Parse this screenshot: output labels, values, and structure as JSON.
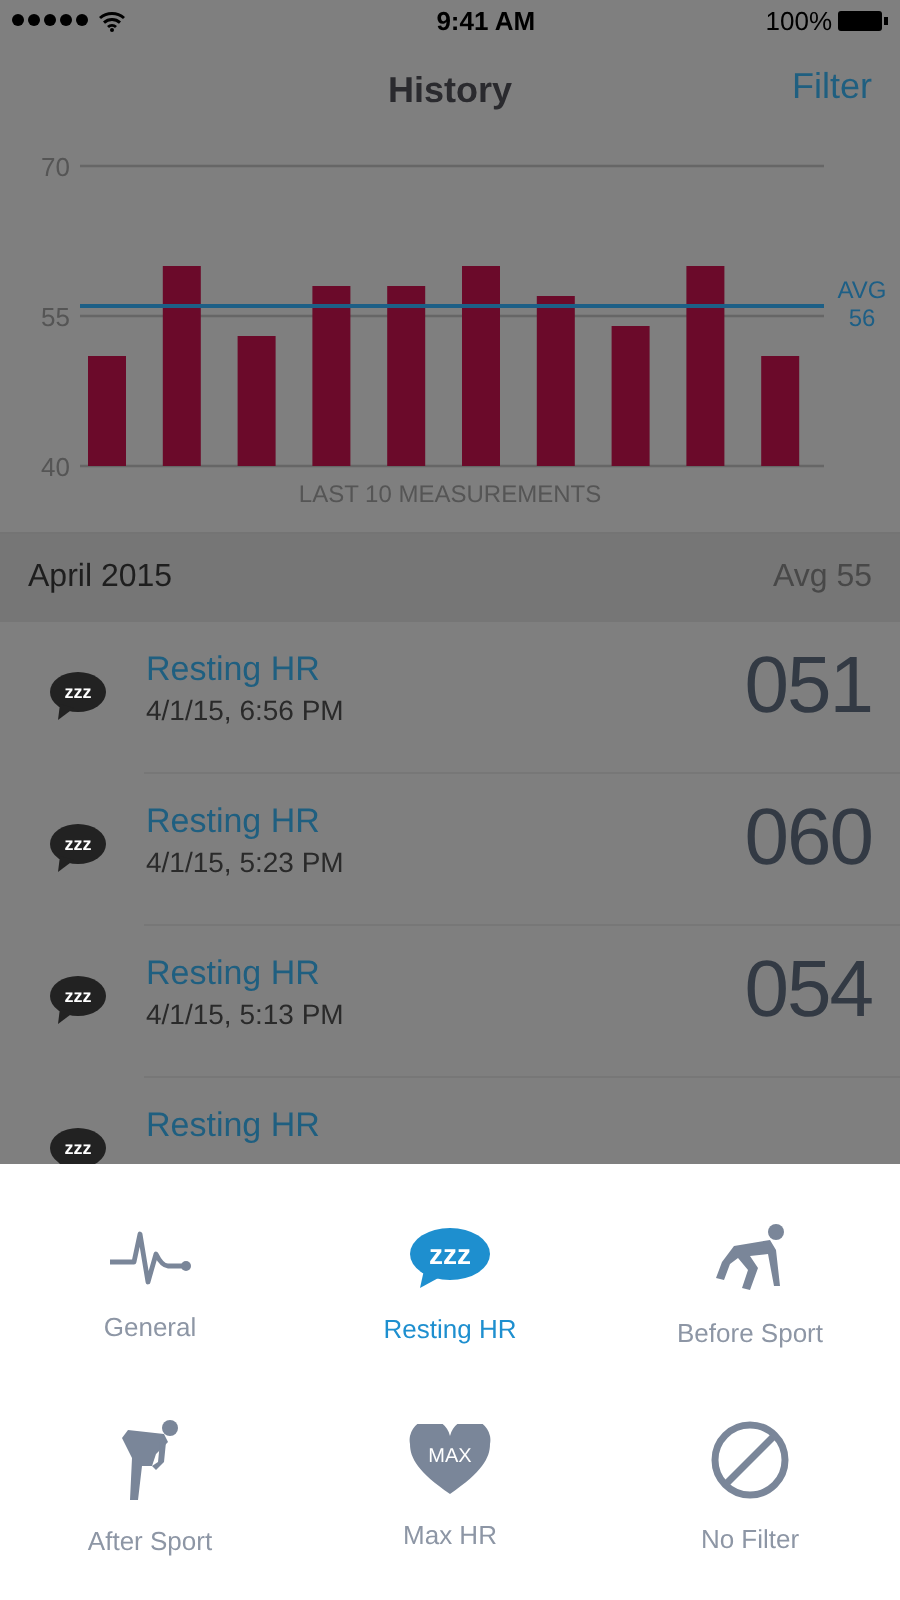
{
  "status_bar": {
    "time": "9:41 AM",
    "battery": "100%"
  },
  "nav": {
    "title": "History",
    "action": "Filter"
  },
  "chart": {
    "chart_data": {
      "type": "bar",
      "xlabel": "LAST 10 MEASUREMENTS",
      "series": [
        {
          "color": "#6b0a2a",
          "values": [
            51,
            60,
            53,
            58,
            58,
            60,
            57,
            54,
            60,
            51
          ]
        }
      ],
      "ylim": [
        40,
        70
      ],
      "yticks": [
        40,
        55,
        70
      ],
      "ref_lines": [
        {
          "axis": "y",
          "value": 56,
          "label": "AVG 56"
        }
      ]
    }
  },
  "section": {
    "title": "April 2015",
    "summary": "Avg 55"
  },
  "rows": [
    {
      "icon_text": "zzz",
      "title": "Resting HR",
      "date": "4/1/15, 6:56 PM",
      "value": "051"
    },
    {
      "icon_text": "zzz",
      "title": "Resting HR",
      "date": "4/1/15, 5:23 PM",
      "value": "060"
    },
    {
      "icon_text": "zzz",
      "title": "Resting HR",
      "date": "4/1/15, 5:13 PM",
      "value": "054"
    },
    {
      "icon_text": "zzz",
      "title": "Resting HR"
    }
  ],
  "filters": [
    {
      "kind": "pulse",
      "label": "General",
      "selected": false
    },
    {
      "kind": "sleep",
      "icon_text": "zzz",
      "label": "Resting HR",
      "selected": true
    },
    {
      "kind": "crouch",
      "label": "Before Sport",
      "selected": false
    },
    {
      "kind": "bent",
      "label": "After Sport",
      "selected": false
    },
    {
      "kind": "heart",
      "icon_text": "MAX",
      "label": "Max HR",
      "selected": false
    },
    {
      "kind": "none",
      "label": "No Filter",
      "selected": false
    }
  ]
}
